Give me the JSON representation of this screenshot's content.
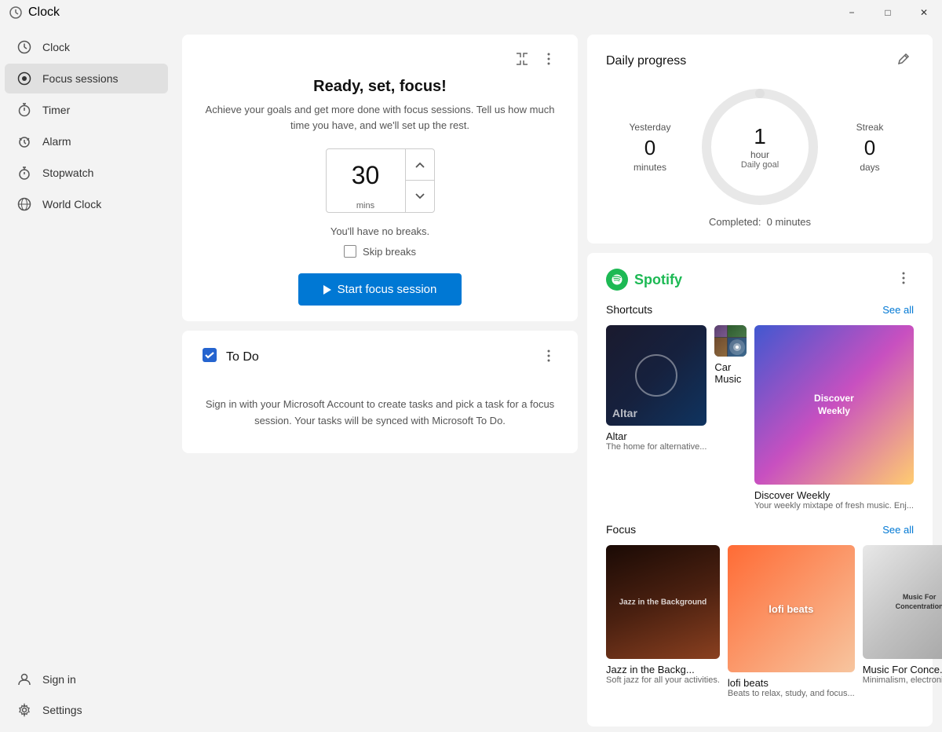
{
  "titlebar": {
    "title": "Clock",
    "minimize_label": "−",
    "maximize_label": "□",
    "close_label": "✕"
  },
  "sidebar": {
    "items": [
      {
        "id": "clock",
        "label": "Clock",
        "icon": "clock-icon"
      },
      {
        "id": "focus-sessions",
        "label": "Focus sessions",
        "icon": "focus-icon",
        "active": true
      },
      {
        "id": "timer",
        "label": "Timer",
        "icon": "timer-icon"
      },
      {
        "id": "alarm",
        "label": "Alarm",
        "icon": "alarm-icon"
      },
      {
        "id": "stopwatch",
        "label": "Stopwatch",
        "icon": "stopwatch-icon"
      },
      {
        "id": "world-clock",
        "label": "World Clock",
        "icon": "worldclock-icon"
      }
    ],
    "bottom_items": [
      {
        "id": "sign-in",
        "label": "Sign in",
        "icon": "signin-icon"
      },
      {
        "id": "settings",
        "label": "Settings",
        "icon": "settings-icon"
      }
    ]
  },
  "focus_card": {
    "title": "Ready, set, focus!",
    "subtitle": "Achieve your goals and get more done with focus sessions. Tell us how much time you have, and we'll set up the rest.",
    "time_value": "30",
    "time_unit": "mins",
    "no_breaks_text": "You'll have no breaks.",
    "skip_breaks_label": "Skip breaks",
    "start_button_label": "Start focus session",
    "expand_icon": "expand-icon",
    "more_icon": "more-icon"
  },
  "todo_card": {
    "title": "To Do",
    "more_icon": "more-icon",
    "body": "Sign in with your Microsoft Account to create tasks and pick a task for a focus session. Your tasks will be synced with Microsoft To Do."
  },
  "daily_progress": {
    "title": "Daily progress",
    "edit_icon": "edit-icon",
    "yesterday_label": "Yesterday",
    "yesterday_value": "0",
    "yesterday_unit": "minutes",
    "daily_goal_label": "Daily goal",
    "daily_goal_value": "1",
    "daily_goal_unit": "hour",
    "streak_label": "Streak",
    "streak_value": "0",
    "streak_unit": "days",
    "completed_label": "Completed:",
    "completed_value": "0 minutes"
  },
  "spotify": {
    "logo_text": "Spotify",
    "more_icon": "more-icon",
    "shortcuts_label": "Shortcuts",
    "see_all_shortcuts": "See all",
    "focus_label": "Focus",
    "see_all_focus": "See all",
    "shortcuts": [
      {
        "id": "altar",
        "name": "Altar",
        "description": "The home for alternative..."
      },
      {
        "id": "car-music",
        "name": "Car Music",
        "description": ""
      },
      {
        "id": "discover-weekly",
        "name": "Discover Weekly",
        "description": "Your weekly mixtape of fresh music. Enj..."
      }
    ],
    "focus_playlists": [
      {
        "id": "jazz-in-background",
        "name": "Jazz in the Backg...",
        "description": "Soft jazz for all your activities."
      },
      {
        "id": "lofi-beats",
        "name": "lofi beats",
        "description": "Beats to relax, study, and focus..."
      },
      {
        "id": "music-for-concentration",
        "name": "Music For Conce...",
        "description": "Minimalism, electronica and..."
      }
    ]
  }
}
